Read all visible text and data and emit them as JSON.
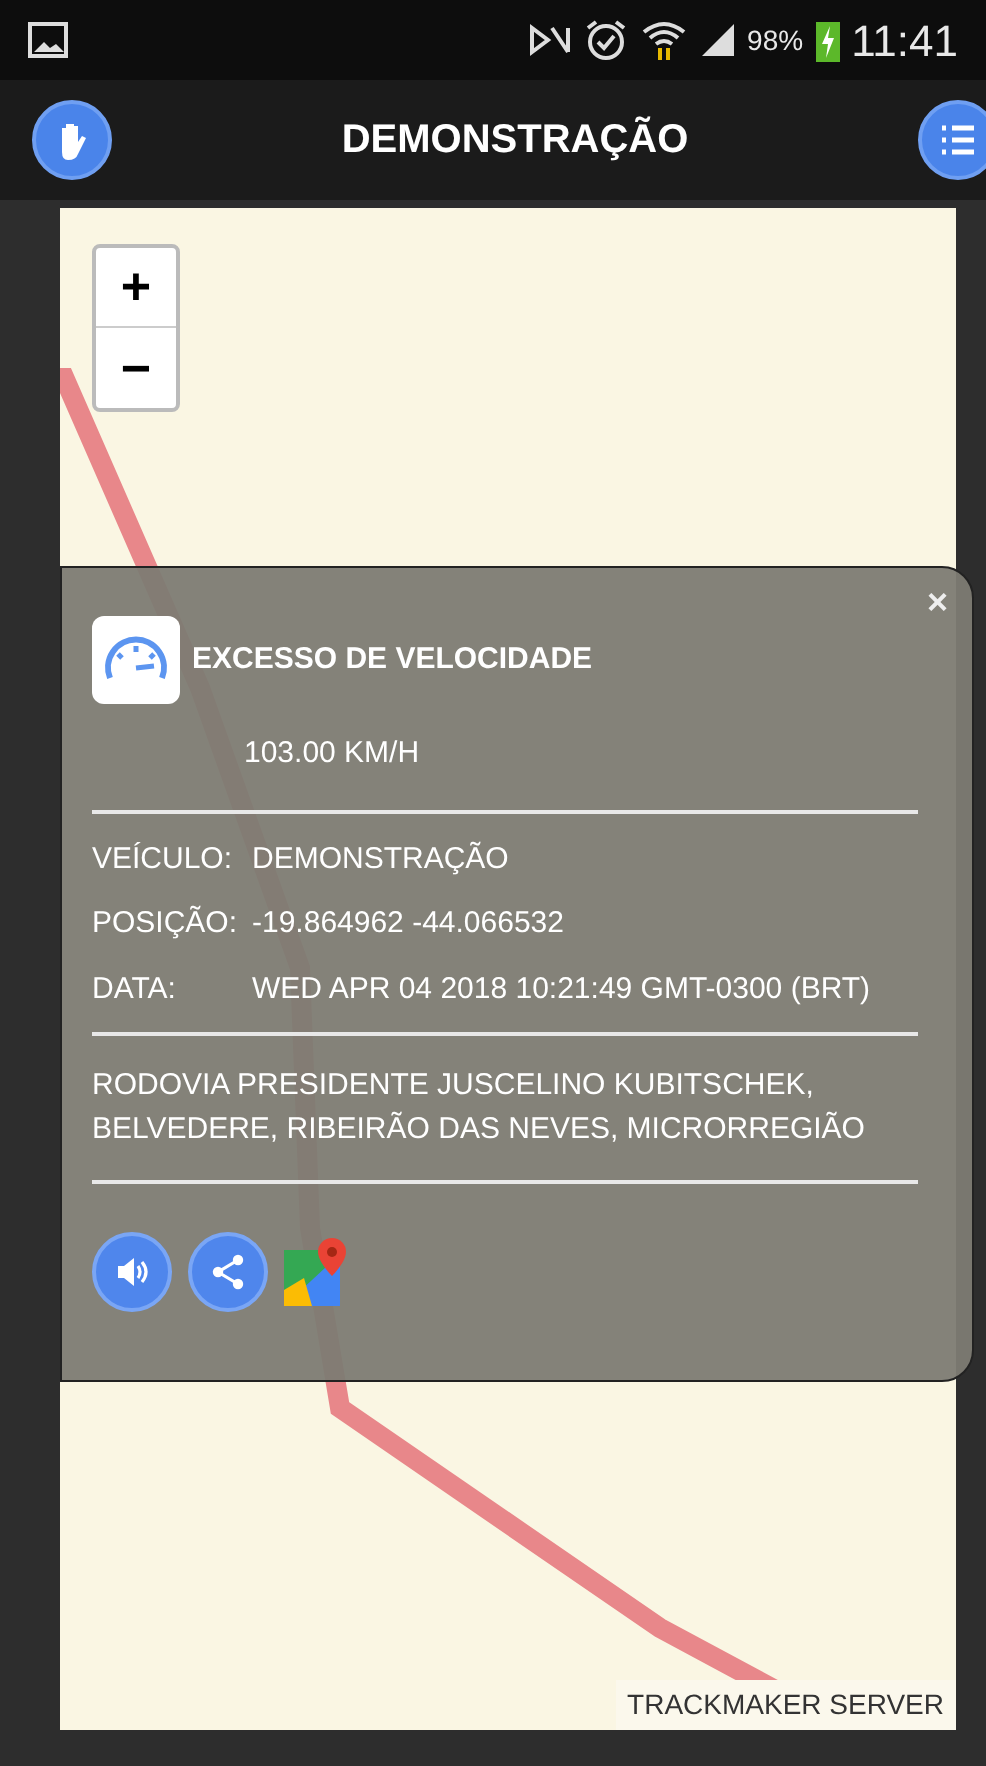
{
  "status_bar": {
    "battery": "98%",
    "time": "11:41"
  },
  "header": {
    "title": "DEMONSTRAÇÃO"
  },
  "map": {
    "zoom_in": "+",
    "zoom_out": "−",
    "attribution": "TRACKMAKER SERVER"
  },
  "popup": {
    "close": "×",
    "title": "EXCESSO DE VELOCIDADE",
    "speed": "103.00 KM/H",
    "details": [
      {
        "label": "VEÍCULO:",
        "value": "DEMONSTRAÇÃO"
      },
      {
        "label": "POSIÇÃO:",
        "value": "-19.864962 -44.066532"
      },
      {
        "label": "DATA:",
        "value": "WED APR 04 2018 10:21:49 GMT-0300 (BRT)"
      }
    ],
    "address": "RODOVIA PRESIDENTE JUSCELINO KUBITSCHEK, BELVEDERE, RIBEIRÃO DAS NEVES, MICRORREGIÃO",
    "actions": [
      {
        "kind": "sound"
      },
      {
        "kind": "share"
      },
      {
        "kind": "maps"
      }
    ]
  }
}
